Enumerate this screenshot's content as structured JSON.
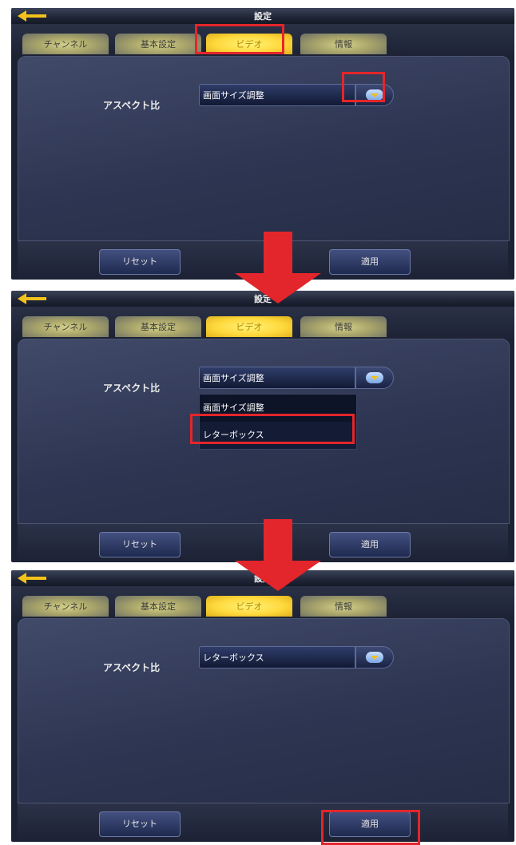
{
  "accent": "#e3262b",
  "steps": [
    {
      "title": "設定",
      "tabs": [
        "チャンネル",
        "基本設定",
        "ビデオ",
        "情報"
      ],
      "aspect_label": "アスペクト比",
      "aspect_value": "画面サイズ調整",
      "reset": "リセット",
      "apply": "適用"
    },
    {
      "title": "設定",
      "tabs": [
        "チャンネル",
        "基本設定",
        "ビデオ",
        "情報"
      ],
      "aspect_label": "アスペクト比",
      "aspect_value": "画面サイズ調整",
      "options": [
        "画面サイズ調整",
        "レターボックス"
      ],
      "reset": "リセット",
      "apply": "適用"
    },
    {
      "title": "設定",
      "tabs": [
        "チャンネル",
        "基本設定",
        "ビデオ",
        "情報"
      ],
      "aspect_label": "アスペクト比",
      "aspect_value": "レターボックス",
      "reset": "リセット",
      "apply": "適用"
    }
  ]
}
